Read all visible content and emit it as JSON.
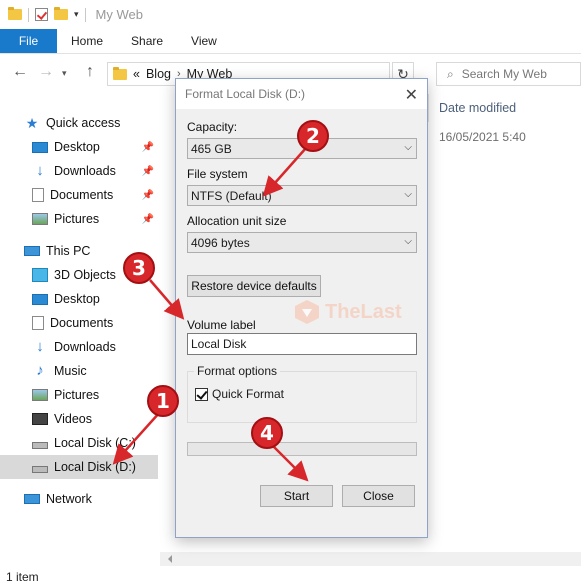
{
  "window": {
    "title": "My Web"
  },
  "quick_access_toolbar": {
    "icons": [
      "folder-icon",
      "properties-check-icon",
      "new-folder-icon",
      "customize-dropdown-icon"
    ]
  },
  "ribbon": {
    "tabs": [
      {
        "label": "File",
        "active": true
      },
      {
        "label": "Home"
      },
      {
        "label": "Share"
      },
      {
        "label": "View"
      }
    ]
  },
  "address": {
    "prefix": "«",
    "crumbs": [
      "Blog",
      "My Web"
    ],
    "search_placeholder": "Search My Web"
  },
  "sidebar": {
    "quick_access": {
      "label": "Quick access",
      "items": [
        {
          "label": "Desktop",
          "pinned": true
        },
        {
          "label": "Downloads",
          "pinned": true
        },
        {
          "label": "Documents",
          "pinned": true
        },
        {
          "label": "Pictures",
          "pinned": true
        }
      ]
    },
    "this_pc": {
      "label": "This PC",
      "items": [
        {
          "label": "3D Objects"
        },
        {
          "label": "Desktop"
        },
        {
          "label": "Documents"
        },
        {
          "label": "Downloads"
        },
        {
          "label": "Music"
        },
        {
          "label": "Pictures"
        },
        {
          "label": "Videos"
        },
        {
          "label": "Local Disk (C:)"
        },
        {
          "label": "Local Disk (D:)",
          "selected": true
        }
      ]
    },
    "network": {
      "label": "Network"
    }
  },
  "content": {
    "column_header": "Date modified",
    "row_date": "16/05/2021 5:40"
  },
  "status_bar": {
    "text": "1 item"
  },
  "dialog": {
    "title": "Format Local Disk (D:)",
    "capacity_label": "Capacity:",
    "capacity_value": "465 GB",
    "filesystem_label": "File system",
    "filesystem_value": "NTFS (Default)",
    "allocation_label": "Allocation unit size",
    "allocation_value": "4096 bytes",
    "restore_button": "Restore device defaults",
    "volume_label_label": "Volume label",
    "volume_label_value": "Local Disk",
    "format_options_label": "Format options",
    "quick_format_label": "Quick Format",
    "quick_format_checked": true,
    "progress": 0,
    "start_button": "Start",
    "close_button": "Close"
  },
  "watermark": {
    "text": "TheLast"
  },
  "annotations": {
    "steps": [
      "1",
      "2",
      "3",
      "4"
    ],
    "color": "#d7272b"
  }
}
